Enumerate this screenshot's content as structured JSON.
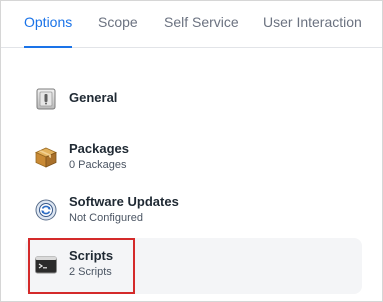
{
  "tabs": {
    "options": "Options",
    "scope": "Scope",
    "self_service": "Self Service",
    "user_interaction": "User Interaction",
    "active": "Options"
  },
  "items": {
    "general": {
      "title": "General",
      "icon": "general-switch-icon"
    },
    "packages": {
      "title": "Packages",
      "subtitle": "0 Packages",
      "icon": "package-box-icon"
    },
    "software_updates": {
      "title": "Software Updates",
      "subtitle": "Not Configured",
      "icon": "software-update-icon"
    },
    "scripts": {
      "title": "Scripts",
      "subtitle": "2 Scripts",
      "icon": "terminal-icon",
      "selected": true
    }
  },
  "colors": {
    "accent": "#1a73e8",
    "highlight": "#d42a2a",
    "selected_bg": "#f4f5f7"
  }
}
